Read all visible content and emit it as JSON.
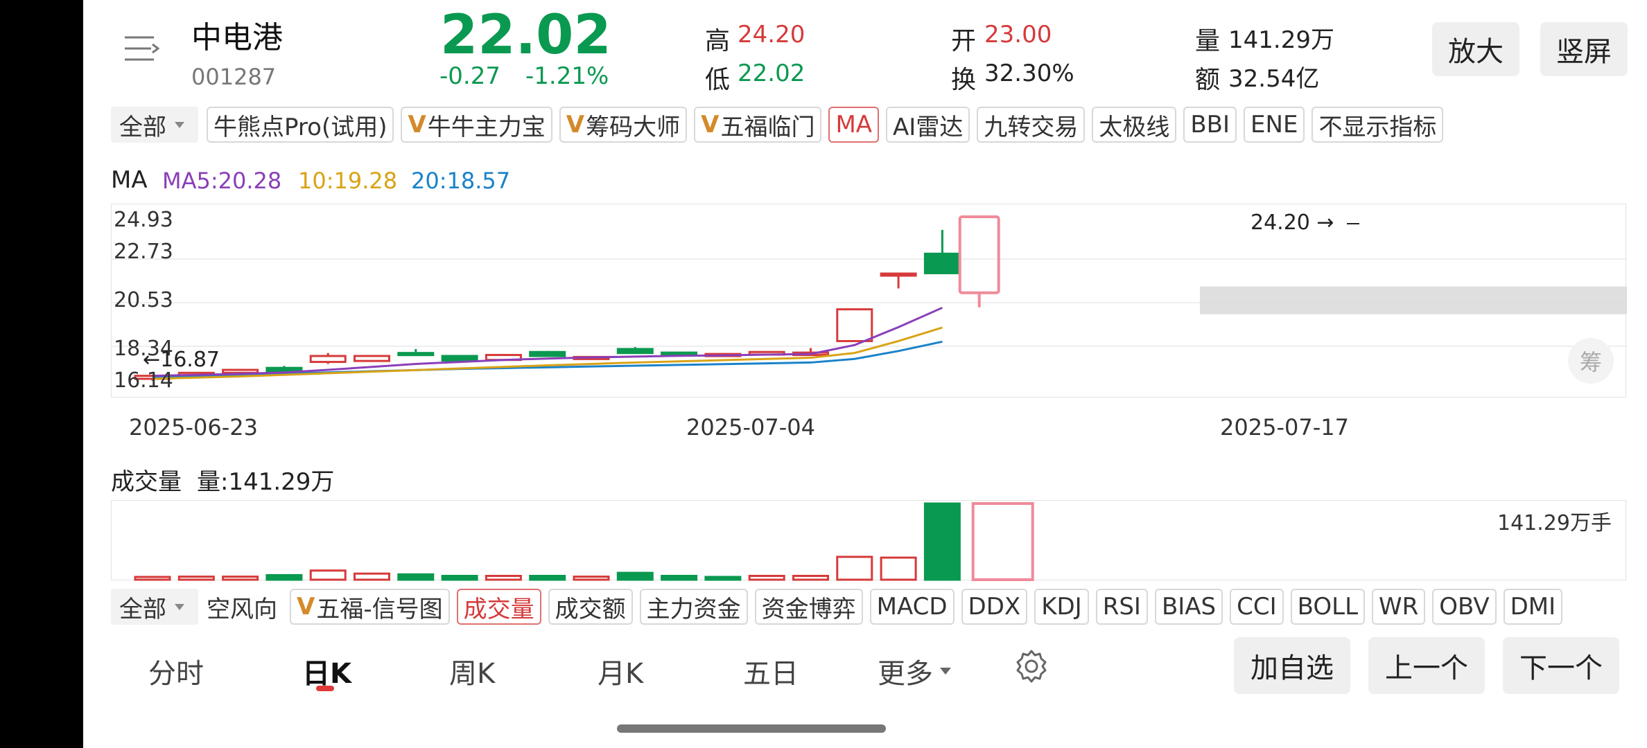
{
  "stock": {
    "name": "中电港",
    "code": "001287",
    "price": "22.02",
    "change": "-0.27",
    "change_pct": "-1.21%",
    "high_label": "高",
    "high": "24.20",
    "low_label": "低",
    "low": "22.02",
    "open_label": "开",
    "open": "23.00",
    "turnover_label": "换",
    "turnover": "32.30%",
    "volume_label": "量",
    "volume": "141.29万",
    "amount_label": "额",
    "amount": "32.54亿"
  },
  "header_buttons": {
    "zoom": "放大",
    "portrait": "竖屏"
  },
  "indicator_bar": {
    "dropdown": "全部",
    "chips": [
      {
        "label": "牛熊点Pro(试用)",
        "v": false,
        "active": false
      },
      {
        "label": "牛牛主力宝",
        "v": true,
        "active": false
      },
      {
        "label": "筹码大师",
        "v": true,
        "active": false
      },
      {
        "label": "五福临门",
        "v": true,
        "active": false
      },
      {
        "label": "MA",
        "v": false,
        "active": true
      },
      {
        "label": "AI雷达",
        "v": false,
        "active": false
      },
      {
        "label": "九转交易",
        "v": false,
        "active": false
      },
      {
        "label": "太极线",
        "v": false,
        "active": false
      },
      {
        "label": "BBI",
        "v": false,
        "active": false
      },
      {
        "label": "ENE",
        "v": false,
        "active": false
      },
      {
        "label": "不显示指标",
        "v": false,
        "active": false
      }
    ]
  },
  "ma_legend": {
    "title": "MA",
    "ma5": "MA5:20.28",
    "ma10": "10:19.28",
    "ma20": "20:18.57",
    "colors": {
      "ma5": "#8a3fb8",
      "ma10": "#d9a316",
      "ma20": "#1a82c9"
    }
  },
  "price_axis": [
    "24.93",
    "22.73",
    "20.53",
    "18.34",
    "16.14"
  ],
  "date_axis": [
    "2025-06-23",
    "2025-07-04",
    "2025-07-17"
  ],
  "annotations": {
    "high_marker": "24.20 →",
    "low_marker": "←16.87",
    "chip_button": "筹"
  },
  "chart_data": {
    "type": "candlestick",
    "ylim": [
      16.14,
      24.93
    ],
    "colors": {
      "up": "#d63a3a",
      "down": "#0a9950"
    },
    "candles": [
      {
        "o": 16.7,
        "c": 16.85,
        "h": 16.9,
        "l": 16.6
      },
      {
        "o": 16.85,
        "c": 17.0,
        "h": 17.05,
        "l": 16.8
      },
      {
        "o": 17.0,
        "c": 17.15,
        "h": 17.2,
        "l": 16.95
      },
      {
        "o": 17.25,
        "c": 17.05,
        "h": 17.35,
        "l": 17.0
      },
      {
        "o": 17.55,
        "c": 17.85,
        "h": 18.0,
        "l": 17.45
      },
      {
        "o": 17.6,
        "c": 17.85,
        "h": 17.9,
        "l": 17.55
      },
      {
        "o": 18.0,
        "c": 17.92,
        "h": 18.2,
        "l": 17.85
      },
      {
        "o": 17.85,
        "c": 17.62,
        "h": 17.9,
        "l": 17.55
      },
      {
        "o": 17.65,
        "c": 17.9,
        "h": 17.95,
        "l": 17.6
      },
      {
        "o": 18.05,
        "c": 17.85,
        "h": 18.1,
        "l": 17.8
      },
      {
        "o": 17.75,
        "c": 17.8,
        "h": 17.85,
        "l": 17.7
      },
      {
        "o": 18.2,
        "c": 18.0,
        "h": 18.3,
        "l": 17.95
      },
      {
        "o": 18.02,
        "c": 17.92,
        "h": 18.05,
        "l": 17.9
      },
      {
        "o": 17.9,
        "c": 17.95,
        "h": 17.98,
        "l": 17.88
      },
      {
        "o": 17.92,
        "c": 18.05,
        "h": 18.08,
        "l": 17.88
      },
      {
        "o": 17.9,
        "c": 18.02,
        "h": 18.25,
        "l": 17.85
      },
      {
        "o": 18.6,
        "c": 20.2,
        "h": 20.25,
        "l": 18.55
      },
      {
        "o": 21.9,
        "c": 22.0,
        "h": 22.05,
        "l": 21.25
      },
      {
        "o": 23.0,
        "c": 22.02,
        "h": 24.2,
        "l": 22.02
      }
    ],
    "ma5": [
      16.85,
      16.9,
      16.95,
      17.02,
      17.15,
      17.3,
      17.45,
      17.55,
      17.65,
      17.72,
      17.78,
      17.82,
      17.86,
      17.88,
      17.92,
      17.95,
      18.4,
      19.3,
      20.28
    ],
    "ma10": [
      16.7,
      16.76,
      16.82,
      16.9,
      16.98,
      17.06,
      17.14,
      17.22,
      17.3,
      17.38,
      17.45,
      17.52,
      17.58,
      17.64,
      17.7,
      17.76,
      18.0,
      18.6,
      19.28
    ],
    "ma20": [
      16.8,
      16.85,
      16.9,
      16.96,
      17.02,
      17.08,
      17.14,
      17.2,
      17.24,
      17.28,
      17.32,
      17.36,
      17.4,
      17.44,
      17.48,
      17.52,
      17.7,
      18.1,
      18.57
    ]
  },
  "volume": {
    "title": "成交量",
    "value_label": "量:141.29万",
    "max_label": "141.29万手",
    "bars": [
      3,
      4,
      4,
      6,
      12,
      8,
      7,
      5,
      5,
      5,
      4,
      9,
      5,
      3,
      5,
      5,
      30,
      29,
      100
    ],
    "up": [
      true,
      true,
      true,
      false,
      true,
      true,
      false,
      false,
      true,
      false,
      true,
      false,
      false,
      false,
      true,
      true,
      true,
      true,
      false
    ]
  },
  "sub_indicator_bar": {
    "dropdown": "全部",
    "chips": [
      {
        "label": "空风向",
        "v": false,
        "active": false,
        "plain": true
      },
      {
        "label": "五福-信号图",
        "v": true,
        "active": false
      },
      {
        "label": "成交量",
        "v": false,
        "active": true
      },
      {
        "label": "成交额",
        "v": false,
        "active": false
      },
      {
        "label": "主力资金",
        "v": false,
        "active": false
      },
      {
        "label": "资金博弈",
        "v": false,
        "active": false
      },
      {
        "label": "MACD",
        "v": false,
        "active": false
      },
      {
        "label": "DDX",
        "v": false,
        "active": false
      },
      {
        "label": "KDJ",
        "v": false,
        "active": false
      },
      {
        "label": "RSI",
        "v": false,
        "active": false
      },
      {
        "label": "BIAS",
        "v": false,
        "active": false
      },
      {
        "label": "CCI",
        "v": false,
        "active": false
      },
      {
        "label": "BOLL",
        "v": false,
        "active": false
      },
      {
        "label": "WR",
        "v": false,
        "active": false
      },
      {
        "label": "OBV",
        "v": false,
        "active": false
      },
      {
        "label": "DMI",
        "v": false,
        "active": false
      }
    ]
  },
  "bottom_tabs": [
    "分时",
    "日K",
    "周K",
    "月K",
    "五日",
    "更多"
  ],
  "bottom_buttons": {
    "add": "加自选",
    "prev": "上一个",
    "next": "下一个"
  }
}
